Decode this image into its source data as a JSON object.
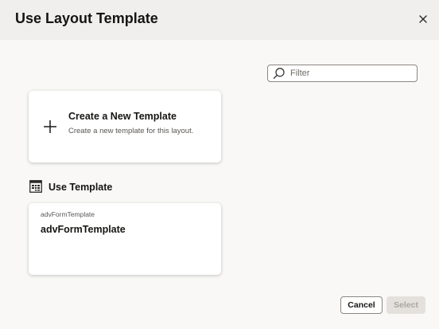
{
  "dialog": {
    "title": "Use Layout Template",
    "close_icon": "close-icon"
  },
  "filter": {
    "placeholder": "Filter",
    "value": "",
    "icon": "search-icon"
  },
  "create_card": {
    "icon": "plus-icon",
    "title": "Create a New Template",
    "description": "Create a new template for this layout."
  },
  "use_template_section": {
    "icon": "template-grid-icon",
    "title": "Use Template",
    "templates": [
      {
        "id_label": "advFormTemplate",
        "name": "advFormTemplate"
      }
    ]
  },
  "footer": {
    "cancel_label": "Cancel",
    "select_label": "Select",
    "select_disabled": true
  }
}
